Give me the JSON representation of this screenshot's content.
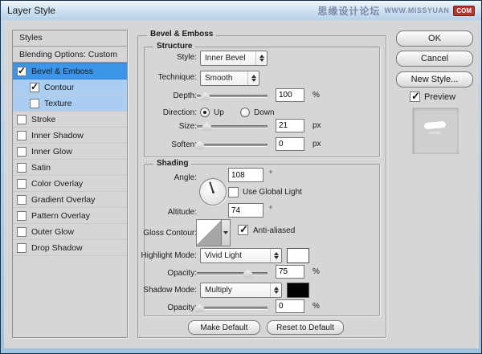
{
  "titlebar": {
    "title": "Layer Style",
    "watermark_cn": "思缘设计论坛",
    "watermark_url": "WWW.MISSYUAN",
    "watermark_badge": "COM"
  },
  "styles_panel": {
    "header": "Styles",
    "items": [
      {
        "label": "Blending Options: Custom",
        "checked": null,
        "selected": false
      },
      {
        "label": "Bevel & Emboss",
        "checked": true,
        "selected": true
      },
      {
        "label": "Contour",
        "checked": true,
        "selected": false
      },
      {
        "label": "Texture",
        "checked": false,
        "selected": false
      },
      {
        "label": "Stroke",
        "checked": false,
        "selected": false
      },
      {
        "label": "Inner Shadow",
        "checked": false,
        "selected": false
      },
      {
        "label": "Inner Glow",
        "checked": false,
        "selected": false
      },
      {
        "label": "Satin",
        "checked": false,
        "selected": false
      },
      {
        "label": "Color Overlay",
        "checked": false,
        "selected": false
      },
      {
        "label": "Gradient Overlay",
        "checked": false,
        "selected": false
      },
      {
        "label": "Pattern Overlay",
        "checked": false,
        "selected": false
      },
      {
        "label": "Outer Glow",
        "checked": false,
        "selected": false
      },
      {
        "label": "Drop Shadow",
        "checked": false,
        "selected": false
      }
    ]
  },
  "main": {
    "group_title": "Bevel & Emboss",
    "structure": {
      "title": "Structure",
      "style_label": "Style:",
      "style_value": "Inner Bevel",
      "technique_label": "Technique:",
      "technique_value": "Smooth",
      "depth_label": "Depth:",
      "depth_value": "100",
      "depth_unit": "%",
      "direction_label": "Direction:",
      "direction_up": "Up",
      "direction_down": "Down",
      "size_label": "Size:",
      "size_value": "21",
      "size_unit": "px",
      "soften_label": "Soften:",
      "soften_value": "0",
      "soften_unit": "px"
    },
    "shading": {
      "title": "Shading",
      "angle_label": "Angle:",
      "angle_value": "108",
      "angle_unit": "°",
      "use_global_light": "Use Global Light",
      "altitude_label": "Altitude:",
      "altitude_value": "74",
      "altitude_unit": "°",
      "gloss_label": "Gloss Contour:",
      "anti_aliased": "Anti-aliased",
      "highlight_mode_label": "Highlight Mode:",
      "highlight_mode_value": "Vivid Light",
      "opacity1_label": "Opacity:",
      "opacity1_value": "75",
      "opacity1_unit": "%",
      "shadow_mode_label": "Shadow Mode:",
      "shadow_mode_value": "Multiply",
      "opacity2_label": "Opacity:",
      "opacity2_value": "0",
      "opacity2_unit": "%"
    },
    "footer": {
      "make_default": "Make Default",
      "reset_to_default": "Reset to Default"
    }
  },
  "right_panel": {
    "ok": "OK",
    "cancel": "Cancel",
    "new_style": "New Style...",
    "preview": "Preview"
  },
  "colors": {
    "dialog_bg": "#d6d6d6",
    "frame_blue": "#b6d1e9",
    "selected_row_blue": "#3c95e8",
    "child_row_blue": "#aacdf2",
    "highlight_swatch": "#ffffff",
    "shadow_swatch": "#000000",
    "watermark_badge_bg": "#b5342c"
  }
}
